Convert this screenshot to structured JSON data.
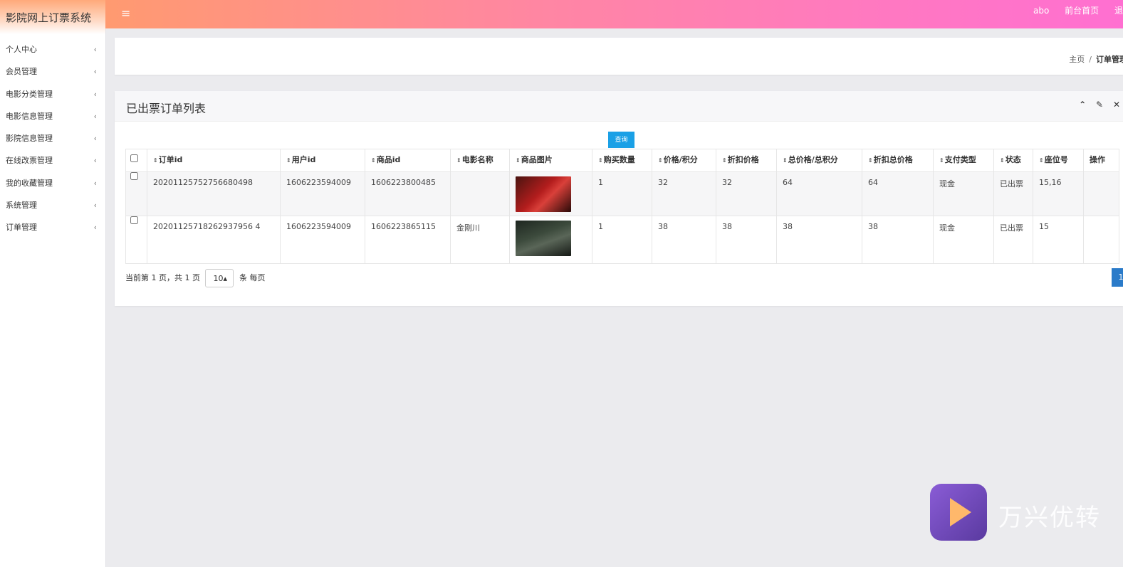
{
  "app": {
    "title": "影院网上订票系统"
  },
  "sidebar": {
    "items": [
      {
        "label": "个人中心"
      },
      {
        "label": "会员管理"
      },
      {
        "label": "电影分类管理"
      },
      {
        "label": "电影信息管理"
      },
      {
        "label": "影院信息管理"
      },
      {
        "label": "在线改票管理"
      },
      {
        "label": "我的收藏管理"
      },
      {
        "label": "系统管理"
      },
      {
        "label": "订单管理"
      }
    ],
    "chevron": "‹"
  },
  "topbar": {
    "menu_icon": "≡",
    "user": "abo",
    "home_link": "前台首页",
    "logout": "退出"
  },
  "breadcrumb": {
    "home": "主页",
    "separator": "/",
    "current": "订单管理"
  },
  "panel": {
    "title": "已出票订单列表",
    "tools": {
      "collapse": "⌃",
      "settings": "✎",
      "close": "✕"
    },
    "query_label": "查询"
  },
  "table": {
    "sort_icon": "⇕",
    "headers": [
      "订单id",
      "用户id",
      "商品id",
      "电影名称",
      "商品图片",
      "购买数量",
      "价格/积分",
      "折扣价格",
      "总价格/总积分",
      "折扣总价格",
      "支付类型",
      "状态",
      "座位号",
      "操作"
    ],
    "rows": [
      {
        "order_id": "20201125752756680498",
        "user_id": "1606223594009",
        "product_id": "1606223800485",
        "movie": "",
        "qty": "1",
        "price": "32",
        "discount_price": "32",
        "total": "64",
        "discount_total": "64",
        "pay_type": "现金",
        "status": "已出票",
        "seats": "15,16"
      },
      {
        "order_id": "20201125718262937956 4",
        "user_id": "1606223594009",
        "product_id": "1606223865115",
        "movie": "金刚川",
        "qty": "1",
        "price": "38",
        "discount_price": "38",
        "total": "38",
        "discount_total": "38",
        "pay_type": "现金",
        "status": "已出票",
        "seats": "15"
      }
    ]
  },
  "pager": {
    "info": "当前第 1 页，共 1 页",
    "page_size": "10",
    "per_page_suffix": "条 每页",
    "current_page": "1"
  },
  "watermark": {
    "text": "万兴优转"
  }
}
